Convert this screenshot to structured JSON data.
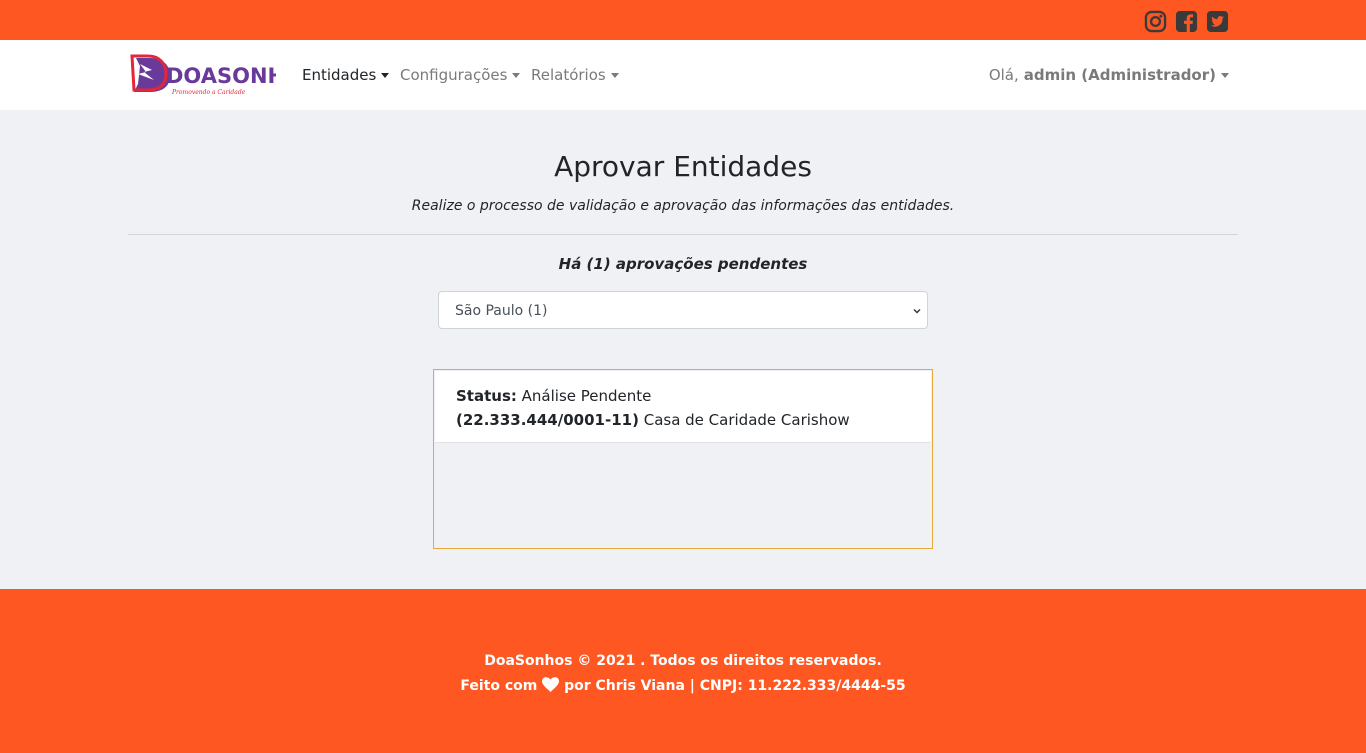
{
  "topbar": {
    "social": [
      "instagram-icon",
      "facebook-icon",
      "twitter-icon"
    ],
    "color": "#ff5722"
  },
  "navbar": {
    "brand": "DOASONHOS",
    "brand_tagline": "Promovendo a Caridade",
    "items": [
      {
        "label": "Entidades",
        "active": true
      },
      {
        "label": "Configurações",
        "active": false
      },
      {
        "label": "Relatórios",
        "active": false
      }
    ],
    "greeting": "Olá,",
    "user": "admin (Administrador)"
  },
  "main": {
    "title": "Aprovar Entidades",
    "subtitle": "Realize o processo de validação e aprovação das informações das entidades.",
    "pending": "Há (1) aprovações pendentes",
    "select_value": "São Paulo (1)",
    "entity": {
      "status_label": "Status:",
      "status_value": "Análise Pendente",
      "cnpj": "(22.333.444/0001-11)",
      "name": "Casa de Caridade Carishow"
    }
  },
  "footer": {
    "line1": "DoaSonhos © 2021 . Todos os direitos reservados.",
    "made_with": "Feito com",
    "made_by": "por Chris Viana | CNPJ: 11.222.333/4444-55"
  },
  "colors": {
    "accent": "#ff5722",
    "card_border": "#e8a93a",
    "brand_red": "#e3263a",
    "brand_purple": "#6a3a9a"
  }
}
